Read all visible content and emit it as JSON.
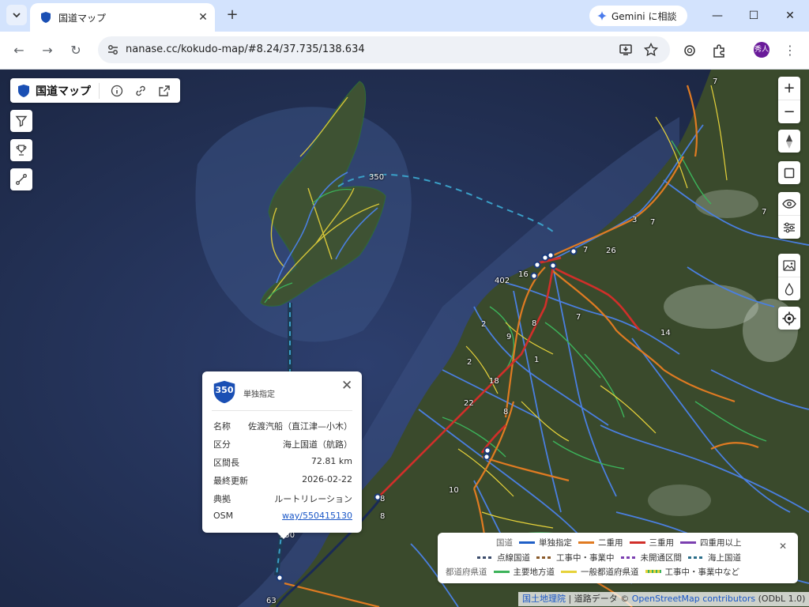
{
  "browser": {
    "tab_title": "国道マップ",
    "new_tab": "+",
    "gemini_label": "Gemini に相談",
    "url": "nanase.cc/kokudo-map/#8.24/37.735/138.634",
    "avatar_text": "秀人"
  },
  "app": {
    "title": "国道マップ"
  },
  "map": {
    "route_labels": [
      "350",
      "7",
      "7",
      "7",
      "3",
      "26",
      "16",
      "402",
      "8",
      "2",
      "9",
      "7",
      "1",
      "18",
      "22",
      "2",
      "8",
      "14",
      "8",
      "10",
      "8",
      "63",
      "7"
    ],
    "colors": {
      "sea": "#22305a",
      "land": "#3a4d2e",
      "single": "#1f5fc7",
      "double": "#e07b22",
      "triple": "#d12f2a",
      "quad": "#7b3fb0",
      "ferry": "#3aa0c8",
      "prefectural": "#e6d23a",
      "major": "#3cb35a"
    }
  },
  "popup": {
    "route_number": "350",
    "classification": "単独指定",
    "rows": [
      {
        "key": "名称",
        "value": "佐渡汽船（直江津—小木）"
      },
      {
        "key": "区分",
        "value": "海上国道（航路）"
      },
      {
        "key": "区間長",
        "value": "72.81 km"
      },
      {
        "key": "最終更新",
        "value": "2026-02-22"
      },
      {
        "key": "典拠",
        "value": "ルートリレーション"
      },
      {
        "key": "OSM",
        "value": "way/550415130"
      }
    ],
    "tail_label": "350"
  },
  "legend": {
    "row1_cat": "国道",
    "row1": [
      {
        "label": "単独指定",
        "color": "#1f5fc7",
        "style": "solid"
      },
      {
        "label": "二重用",
        "color": "#e07b22",
        "style": "solid"
      },
      {
        "label": "三重用",
        "color": "#d12f2a",
        "style": "solid"
      },
      {
        "label": "四重用以上",
        "color": "#7b3fb0",
        "style": "solid"
      }
    ],
    "row2": [
      {
        "label": "点線国道",
        "color": "#3b4b6b",
        "style": "dashed"
      },
      {
        "label": "工事中・事業中",
        "color": "#8a5a2a",
        "style": "dashed"
      },
      {
        "label": "未開通区間",
        "color": "#7b3fb0",
        "style": "dashed"
      },
      {
        "label": "海上国道",
        "color": "#2b6e8a",
        "style": "dashed"
      }
    ],
    "row3_cat": "都道府県道",
    "row3": [
      {
        "label": "主要地方道",
        "color": "#3cb35a",
        "style": "solid"
      },
      {
        "label": "一般都道府県道",
        "color": "#e6d23a",
        "style": "solid"
      },
      {
        "label": "工事中・事業中など",
        "color": "#e6d23a",
        "style": "dotted"
      }
    ]
  },
  "attribution": {
    "gsi": "国土地理院",
    "sep": "|",
    "road": "道路データ ©",
    "osm": "OpenStreetMap contributors",
    "odbl": "(ODbL 1.0)"
  }
}
